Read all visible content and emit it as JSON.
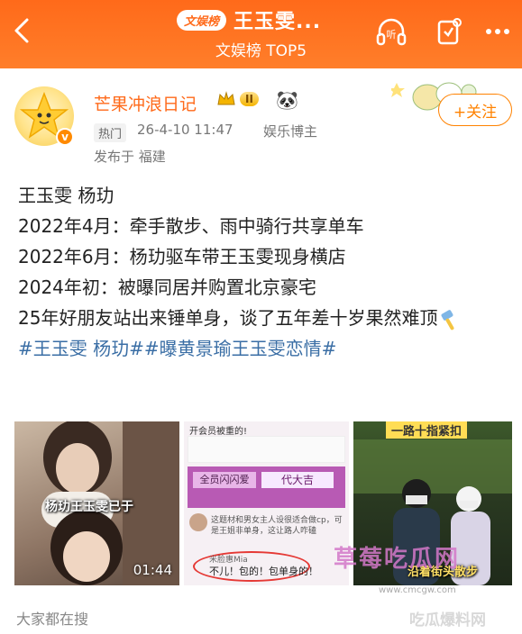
{
  "header": {
    "badge": "文娱榜",
    "title": "王玉雯...",
    "subtitle": "文娱榜 TOP5",
    "listen_label": "听"
  },
  "profile": {
    "username": "芒果冲浪日记",
    "level": "II",
    "hot_tag": "热门",
    "timestamp": "26-4-10 11:47",
    "role": "娱乐博主",
    "location": "发布于 福建",
    "follow_label": "+关注"
  },
  "post": {
    "lines": [
      "王玉雯 杨玏",
      "2022年4月：牵手散步、雨中骑行共享单车",
      "2022年6月：杨玏驱车带王玉雯现身横店",
      "2024年初：被曝同居并购置北京豪宅",
      "25年好朋友站出来锤单身，谈了五年差十岁果然难顶"
    ],
    "tags": "#王玉雯 杨玏##曝黄景瑜王玉雯恋情#"
  },
  "images": {
    "img1_caption": "杨玏王玉雯已于",
    "img1_duration": "01:44",
    "img2_top": "开会员被重的!",
    "img2_strip1": "全员闪闪爱",
    "img2_strip2": "代大吉",
    "img2_comment1": "这题材和男女主人设很适合做cp，可是王姐非单身，这让路人咋磕",
    "img2_user": "米脸惠Mia",
    "img2_comment2": "不儿！包的！包单身的！",
    "img3_top": "一路十指紧扣",
    "img3_bottom": "沿着街头散步"
  },
  "watermarks": {
    "w1": "草莓吃瓜网",
    "w2": "www.cmcgw.com",
    "w3": "吃瓜爆料网"
  },
  "footer": {
    "search_label": "大家都在搜"
  },
  "colors": {
    "accent": "#ff6a1a",
    "link": "#3a6ea5",
    "follow": "#ff8200"
  }
}
